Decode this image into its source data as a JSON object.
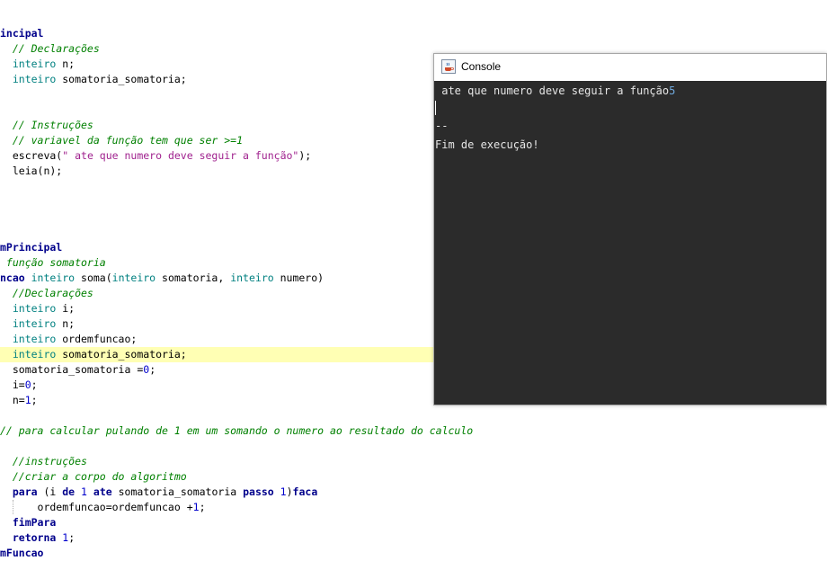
{
  "editor": {
    "lines": [
      {
        "name": "code-line-programa",
        "tokens": [
          {
            "t": "incipal",
            "c": "kw"
          }
        ]
      },
      {
        "name": "code-line-comment-declaracoes",
        "tokens": [
          {
            "t": "  // Declarações",
            "c": "comment"
          }
        ]
      },
      {
        "name": "code-line-decl-n",
        "tokens": [
          {
            "t": "  inteiro",
            "c": "type"
          },
          {
            "t": " n;",
            "c": "plain"
          }
        ]
      },
      {
        "name": "code-line-decl-somatoria",
        "tokens": [
          {
            "t": "  inteiro",
            "c": "type"
          },
          {
            "t": " somatoria_somatoria;",
            "c": "plain"
          }
        ]
      },
      {
        "name": "code-line-blank",
        "tokens": []
      },
      {
        "name": "code-line-blank",
        "tokens": []
      },
      {
        "name": "code-line-comment-instrucoes",
        "tokens": [
          {
            "t": "  // Instruções",
            "c": "comment"
          }
        ]
      },
      {
        "name": "code-line-comment-variavel",
        "tokens": [
          {
            "t": "  // variavel da função tem que ser >=1",
            "c": "comment"
          }
        ]
      },
      {
        "name": "code-line-escreva",
        "tokens": [
          {
            "t": "  escreva(",
            "c": "plain"
          },
          {
            "t": "\" ate que numero deve seguir a função\"",
            "c": "str"
          },
          {
            "t": ");",
            "c": "plain"
          }
        ]
      },
      {
        "name": "code-line-leia",
        "tokens": [
          {
            "t": "  leia(n);",
            "c": "plain"
          }
        ]
      },
      {
        "name": "code-line-blank",
        "tokens": []
      },
      {
        "name": "code-line-blank",
        "tokens": []
      },
      {
        "name": "code-line-blank",
        "tokens": []
      },
      {
        "name": "code-line-blank",
        "tokens": []
      },
      {
        "name": "code-line-fimprincipal",
        "tokens": [
          {
            "t": "mPrincipal",
            "c": "kw"
          }
        ]
      },
      {
        "name": "code-line-comment-funcao-somatoria",
        "tokens": [
          {
            "t": " função somatoria",
            "c": "comment"
          }
        ]
      },
      {
        "name": "code-line-funcao-soma",
        "tokens": [
          {
            "t": "ncao",
            "c": "kw"
          },
          {
            "t": " inteiro",
            "c": "type"
          },
          {
            "t": " soma(",
            "c": "plain"
          },
          {
            "t": "inteiro",
            "c": "type"
          },
          {
            "t": " somatoria, ",
            "c": "plain"
          },
          {
            "t": "inteiro",
            "c": "type"
          },
          {
            "t": " numero)",
            "c": "plain"
          }
        ]
      },
      {
        "name": "code-line-comment-declaracoes2",
        "tokens": [
          {
            "t": "  //Declarações",
            "c": "comment"
          }
        ]
      },
      {
        "name": "code-line-decl-i",
        "tokens": [
          {
            "t": "  inteiro",
            "c": "type"
          },
          {
            "t": " i;",
            "c": "plain"
          }
        ]
      },
      {
        "name": "code-line-decl-n2",
        "tokens": [
          {
            "t": "  inteiro",
            "c": "type"
          },
          {
            "t": " n;",
            "c": "plain"
          }
        ]
      },
      {
        "name": "code-line-decl-ordemfuncao",
        "tokens": [
          {
            "t": "  inteiro",
            "c": "type"
          },
          {
            "t": " ordemfuncao;",
            "c": "plain"
          }
        ]
      },
      {
        "name": "code-line-decl-somatoria2",
        "highlight": true,
        "tokens": [
          {
            "t": "  inteiro",
            "c": "type"
          },
          {
            "t": " somatoria_somatoria;",
            "c": "plain"
          }
        ]
      },
      {
        "name": "code-line-assign-somatoria",
        "tokens": [
          {
            "t": "  somatoria_somatoria =",
            "c": "plain"
          },
          {
            "t": "0",
            "c": "num"
          },
          {
            "t": ";",
            "c": "plain"
          }
        ]
      },
      {
        "name": "code-line-assign-i",
        "tokens": [
          {
            "t": "  i=",
            "c": "plain"
          },
          {
            "t": "0",
            "c": "num"
          },
          {
            "t": ";",
            "c": "plain"
          }
        ]
      },
      {
        "name": "code-line-assign-n",
        "tokens": [
          {
            "t": "  n=",
            "c": "plain"
          },
          {
            "t": "1",
            "c": "num"
          },
          {
            "t": ";",
            "c": "plain"
          }
        ]
      },
      {
        "name": "code-line-blank",
        "tokens": []
      },
      {
        "name": "code-line-comment-calcular",
        "tokens": [
          {
            "t": "// para calcular pulando de 1 em um somando o numero ao resultado do calculo",
            "c": "comment"
          }
        ]
      },
      {
        "name": "code-line-blank",
        "tokens": []
      },
      {
        "name": "code-line-comment-instrucoes2",
        "tokens": [
          {
            "t": "  //instruções",
            "c": "comment"
          }
        ]
      },
      {
        "name": "code-line-comment-criar",
        "tokens": [
          {
            "t": "  //criar a corpo do algoritmo",
            "c": "comment"
          }
        ]
      },
      {
        "name": "code-line-para",
        "tokens": [
          {
            "t": "  para",
            "c": "kw"
          },
          {
            "t": " (i ",
            "c": "plain"
          },
          {
            "t": "de",
            "c": "kw"
          },
          {
            "t": " ",
            "c": "plain"
          },
          {
            "t": "1",
            "c": "num"
          },
          {
            "t": " ",
            "c": "plain"
          },
          {
            "t": "ate",
            "c": "kw"
          },
          {
            "t": " somatoria_somatoria ",
            "c": "plain"
          },
          {
            "t": "passo",
            "c": "kw"
          },
          {
            "t": " ",
            "c": "plain"
          },
          {
            "t": "1",
            "c": "num"
          },
          {
            "t": ")",
            "c": "plain"
          },
          {
            "t": "faca",
            "c": "kw"
          }
        ]
      },
      {
        "name": "code-line-ordemfuncao-incr",
        "tokens": [
          {
            "t": "      ordemfuncao=ordemfuncao +",
            "c": "plain"
          },
          {
            "t": "1",
            "c": "num"
          },
          {
            "t": ";",
            "c": "plain"
          }
        ]
      },
      {
        "name": "code-line-fimpara",
        "tokens": [
          {
            "t": "  fimPara",
            "c": "kw"
          }
        ]
      },
      {
        "name": "code-line-retorna",
        "tokens": [
          {
            "t": "  retorna",
            "c": "kw"
          },
          {
            "t": " ",
            "c": "plain"
          },
          {
            "t": "1",
            "c": "num"
          },
          {
            "t": ";",
            "c": "plain"
          }
        ]
      },
      {
        "name": "code-line-fimfuncao",
        "tokens": [
          {
            "t": "mFuncao",
            "c": "kw"
          }
        ]
      }
    ]
  },
  "console": {
    "title": "Console",
    "icon": "java-cup-icon",
    "prompt_text": " ate que numero deve seguir a função",
    "input_value": "5",
    "separator": "--",
    "end_message": "Fim de execução!"
  },
  "colors": {
    "keyword": "#00008b",
    "type": "#008080",
    "comment": "#008000",
    "string": "#a0228e",
    "number": "#0000cc",
    "highlight": "#ffffb4",
    "console_bg": "#2b2b2b",
    "console_text": "#e6e6e6",
    "console_input": "#6fa8dc"
  }
}
